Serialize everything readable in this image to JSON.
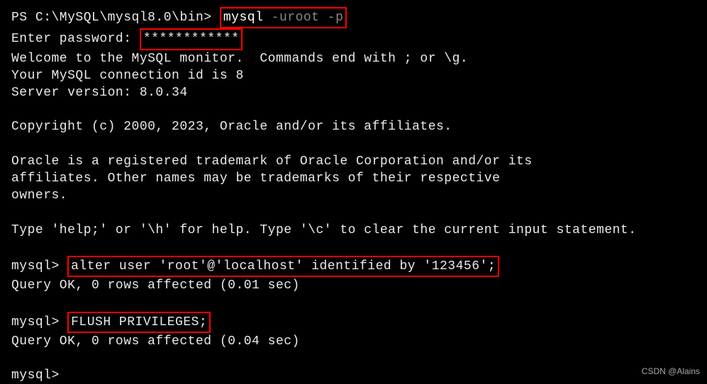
{
  "terminal": {
    "ps_prompt": "PS C:\\MySQL\\mysql8.0\\bin>",
    "mysql_cmd_white": "mysql",
    "mysql_cmd_gray": " -uroot -p",
    "enter_password_label": "Enter password:",
    "password_mask": "************",
    "welcome_line": "Welcome to the MySQL monitor.  Commands end with ; or \\g.",
    "connection_id_line": "Your MySQL connection id is 8",
    "server_version_line": "Server version: 8.0.34",
    "copyright_line": "Copyright (c) 2000, 2023, Oracle and/or its affiliates.",
    "trademark_line1": "Oracle is a registered trademark of Oracle Corporation and/or its",
    "trademark_line2": "affiliates. Other names may be trademarks of their respective",
    "trademark_line3": "owners.",
    "help_line": "Type 'help;' or '\\h' for help. Type '\\c' to clear the current input statement.",
    "mysql_prompt": "mysql>",
    "alter_user_cmd": "alter user 'root'@'localhost' identified by '123456';",
    "query_ok_1": "Query OK, 0 rows affected (0.01 sec)",
    "flush_privileges_cmd": "FLUSH PRIVILEGES;",
    "query_ok_2": "Query OK, 0 rows affected (0.04 sec)"
  },
  "watermark": "CSDN @Alains"
}
